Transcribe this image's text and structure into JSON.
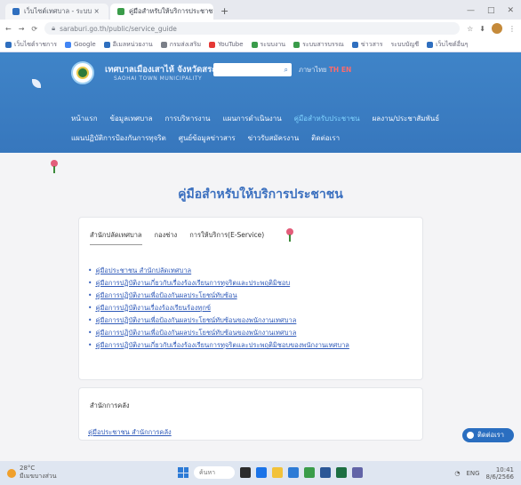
{
  "browser": {
    "tabs": [
      {
        "label": "เว็บไซต์เทศบาล - ระบบ ×",
        "active": false
      },
      {
        "label": "คู่มือสำหรับให้บริการประชาชน ×",
        "active": true
      }
    ],
    "new_tab": "+",
    "window_controls": [
      "—",
      "□",
      "✕"
    ],
    "nav_buttons": [
      "←",
      "→",
      "⟳"
    ],
    "address": "saraburi.go.th/public/service_guide",
    "address_icons": [
      "☆",
      "⬇",
      "⋮"
    ],
    "bookmarks": [
      "เว็บไซต์ราชการ",
      "Google",
      "อีเมลหน่วยงาน",
      "กรมส่งเสริม",
      "YouTube",
      "ระบบงาน",
      "ระบบสารบรรณ",
      "ข่าวสาร",
      "ระบบบัญชี",
      "เว็บไซต์อื่นๆ"
    ]
  },
  "site": {
    "name": "เทศบาลเมืองเสาไห้ จังหวัดสระบุรี",
    "subtitle": "SAOHAI TOWN MUNICIPALITY",
    "search_icon": "⌕",
    "lang_text": "ภาษาไทย",
    "lang_flags": "TH EN",
    "nav_row1": [
      "หน้าแรก",
      "ข้อมูลเทศบาล",
      "การบริหารงาน",
      "แผนการดำเนินงาน",
      "คู่มือสำหรับประชาชน",
      "ผลงาน/ประชาสัมพันธ์"
    ],
    "nav_row1_highlight_index": 4,
    "nav_row2": [
      "แผนปฏิบัติการป้องกันการทุจริต",
      "ศูนย์ข้อมูลข่าวสาร",
      "ข่าวรับสมัครงาน",
      "ติดต่อเรา"
    ]
  },
  "page": {
    "title": "คู่มือสำหรับให้บริการประชาชน",
    "tabs": [
      "สำนักปลัดเทศบาล",
      "กองช่าง",
      "การให้บริการ(E-Service)"
    ],
    "active_tab": 0,
    "links": [
      "คู่มือประชาชน สำนักปลัดเทศบาล",
      "คู่มือการปฏิบัติงานเกี่ยวกับเรื่องร้องเรียนการทุจริตและประพฤติมิชอบ",
      "คู่มือการปฏิบัติงานเพื่อป้องกันผลประโยชน์ทับซ้อน",
      "คู่มือการปฏิบัติงานเรื่องร้องเรียนร้องทุกข์",
      "คู่มือการปฏิบัติงานเพื่อป้องกันผลประโยชน์ทับซ้อนของพนักงานเทศบาล",
      "คู่มือการปฏิบัติงานเพื่อป้องกันผลประโยชน์ทับซ้อนของพนักงานเทศบาล",
      "คู่มือการปฏิบัติงานเกี่ยวกับเรื่องร้องเรียนการทุจริตและประพฤติมิชอบของพนักงานเทศบาล"
    ],
    "section2_title": "สำนักการคลัง",
    "section2_link": "คู่มือประชาชน สำนักการคลัง",
    "chat_label": "ติดต่อเรา"
  },
  "taskbar": {
    "weather_temp": "28°C",
    "weather_text": "มีเมฆบางส่วน",
    "search_label": "ค้นหา",
    "tray_text": "ENG",
    "time": "10:41",
    "date": "8/6/2566"
  },
  "colors": {
    "header_blue": "#3a7cc2",
    "link_blue": "#2e59b8",
    "title_blue": "#3a6fbf",
    "nav_highlight": "#7fd3ff"
  }
}
